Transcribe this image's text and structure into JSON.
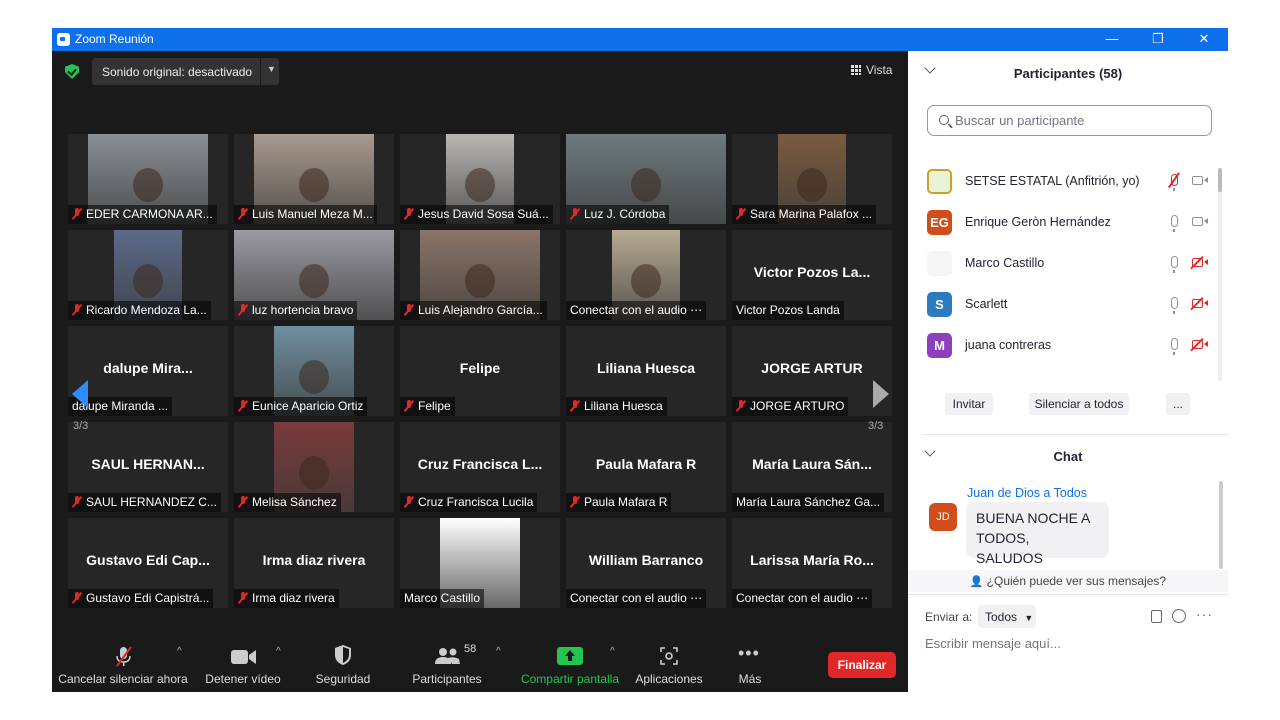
{
  "window": {
    "title": "Zoom Reunión",
    "controls": [
      "—",
      "❐",
      "✕"
    ]
  },
  "top_bar": {
    "audio_label": "Sonido original: desactivado",
    "view_label": "Vista"
  },
  "gallery": {
    "page_left": "3/3",
    "page_right": "3/3",
    "tiles": [
      {
        "caption": "EDER CARMONA AR...",
        "muted": true,
        "video": true,
        "big_name": ""
      },
      {
        "caption": "Luis Manuel Meza M...",
        "muted": true,
        "video": true,
        "big_name": ""
      },
      {
        "caption": "Jesus David Sosa Suá...",
        "muted": true,
        "video": true,
        "big_name": ""
      },
      {
        "caption": "Luz J. Córdoba",
        "muted": true,
        "video": true,
        "big_name": ""
      },
      {
        "caption": "Sara Marina Palafox ...",
        "muted": true,
        "video": true,
        "big_name": ""
      },
      {
        "caption": "Ricardo Mendoza La...",
        "muted": true,
        "video": true,
        "big_name": ""
      },
      {
        "caption": "luz hortencia bravo",
        "muted": true,
        "video": true,
        "big_name": ""
      },
      {
        "caption": "Luis Alejandro García...",
        "muted": true,
        "video": true,
        "big_name": ""
      },
      {
        "caption": "Conectar con el audio ⋯",
        "muted": false,
        "video": true,
        "big_name": ""
      },
      {
        "caption": "Victor Pozos Landa",
        "muted": false,
        "video": false,
        "big_name": "Victor Pozos La..."
      },
      {
        "caption": "dalupe Miranda ...",
        "muted": false,
        "video": false,
        "big_name": "dalupe Mira..."
      },
      {
        "caption": "Eunice Aparicio Ortiz",
        "muted": true,
        "video": true,
        "big_name": ""
      },
      {
        "caption": "Felipe",
        "muted": true,
        "video": false,
        "big_name": "Felipe"
      },
      {
        "caption": "Liliana Huesca",
        "muted": true,
        "video": false,
        "big_name": "Liliana Huesca"
      },
      {
        "caption": "JORGE ARTURO",
        "muted": true,
        "video": false,
        "big_name": "JORGE ARTUR"
      },
      {
        "caption": "SAUL HERNANDEZ C...",
        "muted": true,
        "video": false,
        "big_name": "SAUL HERNAN..."
      },
      {
        "caption": "Melisa Sánchez",
        "muted": true,
        "video": true,
        "big_name": ""
      },
      {
        "caption": "Cruz Francisca Lucila",
        "muted": true,
        "video": false,
        "big_name": "Cruz Francisca L..."
      },
      {
        "caption": "Paula Mafara R",
        "muted": true,
        "video": false,
        "big_name": "Paula Mafara R"
      },
      {
        "caption": "María Laura Sánchez Ga...",
        "muted": false,
        "video": false,
        "big_name": "María Laura Sán..."
      },
      {
        "caption": "Gustavo Edi Capistrá...",
        "muted": true,
        "video": false,
        "big_name": "Gustavo Edi Cap..."
      },
      {
        "caption": "Irma diaz rivera",
        "muted": true,
        "video": false,
        "big_name": "Irma diaz rivera"
      },
      {
        "caption": "Marco Castillo",
        "muted": false,
        "video": true,
        "big_name": ""
      },
      {
        "caption": "Conectar con el audio ⋯",
        "muted": false,
        "video": false,
        "big_name": "William Barranco"
      },
      {
        "caption": "Conectar con el audio ⋯",
        "muted": false,
        "video": false,
        "big_name": "Larissa María Ro..."
      }
    ]
  },
  "toolbar": {
    "unmute_label": "Cancelar silenciar ahora",
    "video_label": "Detener vídeo",
    "security_label": "Seguridad",
    "participants_label": "Participantes",
    "participants_count": "58",
    "share_label": "Compartir pantalla",
    "apps_label": "Aplicaciones",
    "more_label": "Más",
    "end_label": "Finalizar"
  },
  "participants_panel": {
    "title": "Participantes (58)",
    "search_placeholder": "Buscar un participante",
    "list": [
      {
        "name": "SETSE ESTATAL (Anfitrión, yo)",
        "initials": "",
        "color": "#f5f5f5"
      },
      {
        "name": "Enrique Geròn Hernández",
        "initials": "EG",
        "color": "#d14d1b"
      },
      {
        "name": "Marco Castillo",
        "initials": "",
        "color": "#f5f5f5"
      },
      {
        "name": "Scarlett",
        "initials": "S",
        "color": "#2d7ac0"
      },
      {
        "name": "juana contreras",
        "initials": "M",
        "color": "#8e3fc0"
      }
    ],
    "invite_label": "Invitar",
    "mute_all_label": "Silenciar a todos",
    "more_label": "..."
  },
  "chat_panel": {
    "title": "Chat",
    "sender_line": "Juan de Dios a Todos",
    "sender_initials": "JD",
    "message": "BUENA NOCHE A TODOS, SALUDOS",
    "who_can_see": "¿Quién puede ver sus mensajes?",
    "send_to_label": "Enviar a:",
    "send_to_value": "Todos",
    "input_placeholder": "Escribir mensaje aquí..."
  }
}
